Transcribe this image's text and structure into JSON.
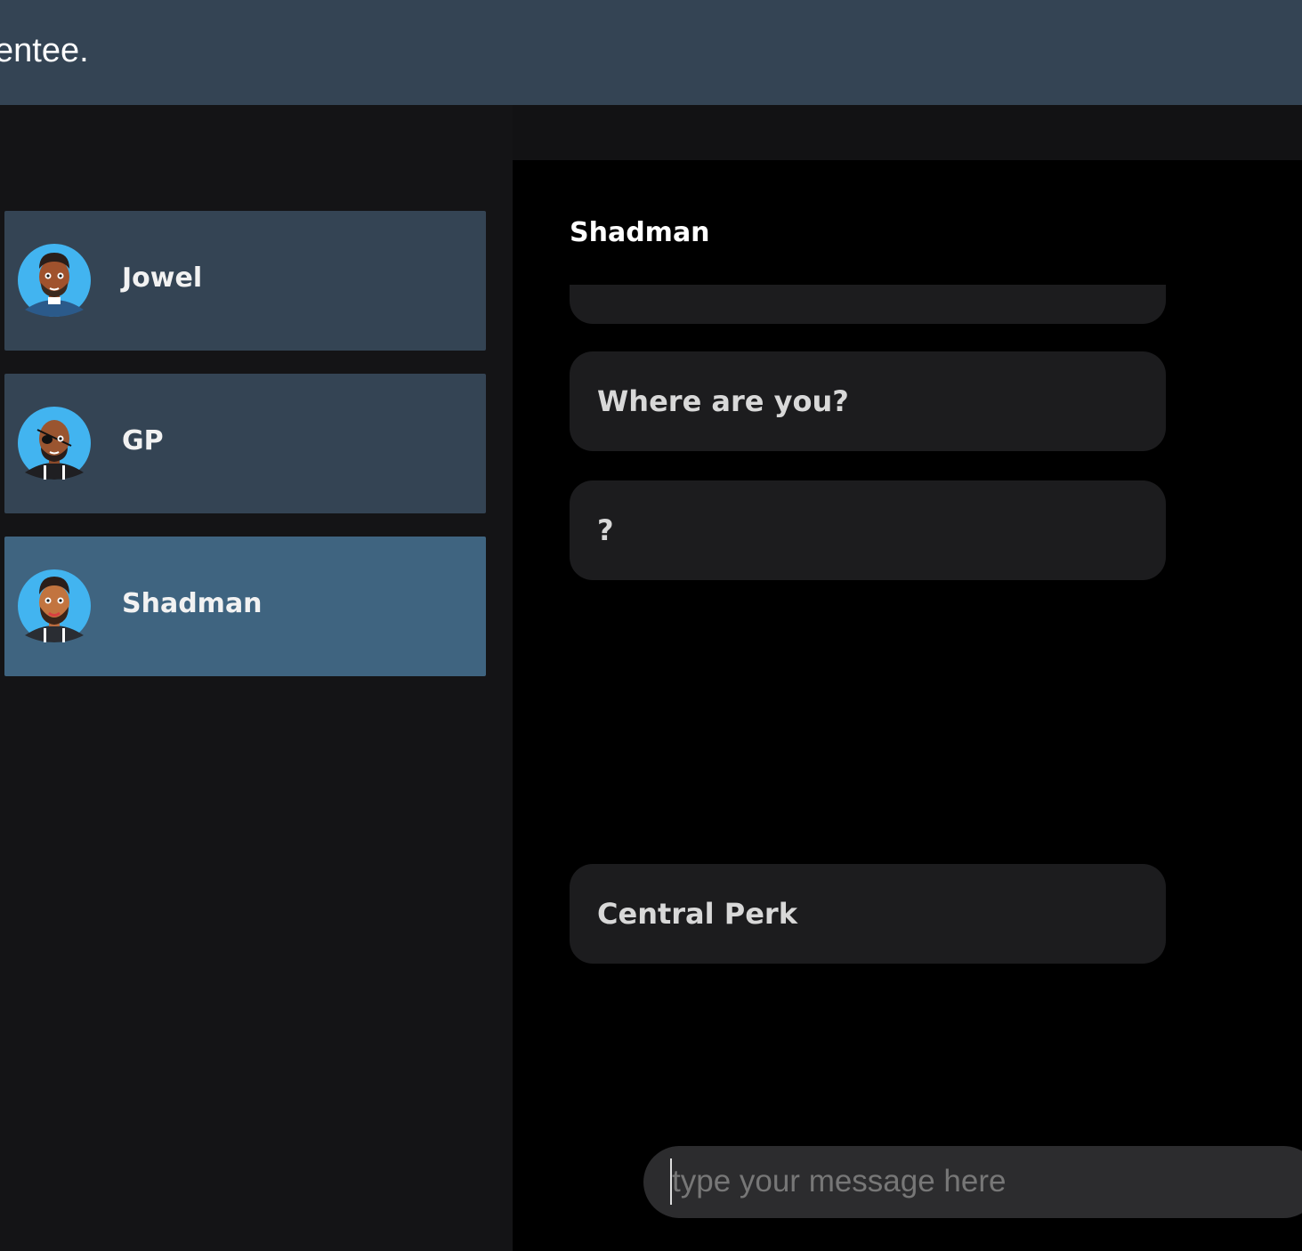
{
  "header": {
    "title": "entee."
  },
  "sidebar": {
    "contacts": [
      {
        "name": "Jowel",
        "avatar": "man-avatar-icon",
        "active": false
      },
      {
        "name": "GP",
        "avatar": "eyepatch-man-avatar-icon",
        "active": false
      },
      {
        "name": "Shadman",
        "avatar": "bearded-man-avatar-icon",
        "active": true
      }
    ]
  },
  "chat": {
    "title": "Shadman",
    "messages": [
      {
        "text": ""
      },
      {
        "text": "Where are you?"
      },
      {
        "text": "?"
      },
      {
        "text": "Central Perk"
      }
    ],
    "input": {
      "value": "",
      "placeholder": "type your message here"
    }
  },
  "colors": {
    "header_bg": "#344454",
    "contact_bg": "#344454",
    "contact_active_bg": "#3f6480",
    "bubble_bg": "#1c1c1e",
    "avatar_circle": "#42b4f0"
  }
}
